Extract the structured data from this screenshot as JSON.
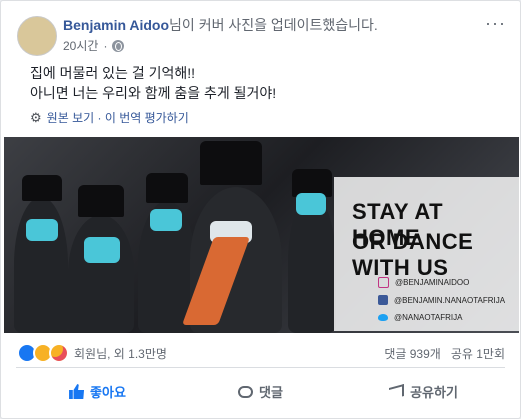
{
  "post": {
    "author": "Benjamin Aidoo",
    "action": "님이 커버 사진을 업데이트했습니다.",
    "time": "20시간",
    "privacy_icon": "globe-icon",
    "more_icon": "more-icon",
    "more": "···",
    "text_line1": "집에 머물러 있는 걸 기억해!!",
    "text_line2": "아니면 너는 우리와 함께 춤을 추게 될거야!",
    "translate_link": "원본 보기 · 이 번역 평가하기",
    "translate_icon": "gear-icon"
  },
  "media": {
    "slogan_line1": "STAY AT HOME",
    "slogan_line2": "OR DANCE WITH US",
    "handle_ig": "@BENJAMINAIDOO",
    "handle_fb": "@BENJAMIN.NANAOTAFRIJA",
    "handle_tw": "@NANAOTAFRIJA"
  },
  "engagement": {
    "reaction_icons": [
      "like-icon",
      "haha-icon",
      "care-icon"
    ],
    "reaction_text": "회원님, 외 1.3만명",
    "comments": "댓글 939개",
    "shares": "공유 1만회"
  },
  "actions": {
    "like": "좋아요",
    "comment": "댓글",
    "share": "공유하기"
  }
}
